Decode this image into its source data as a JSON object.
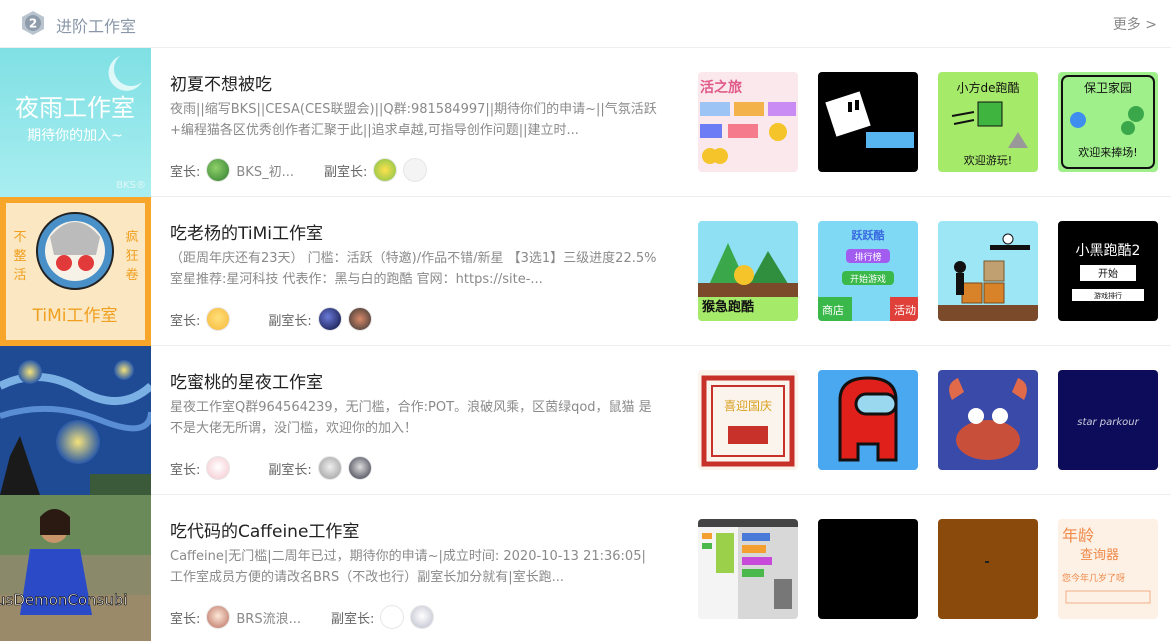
{
  "header": {
    "badge_num": "2",
    "title": "进阶工作室",
    "more": "更多 >"
  },
  "labels": {
    "owner": "室长:",
    "deputy": "副室长:"
  },
  "studios": [
    {
      "name": "初夏不想被吃",
      "desc": "夜雨||缩写BKS||CESA(CES联盟会)||Q群:981584997||期待你们的申请~||气氛活跃+编程猫各区优秀创作者汇聚于此||追求卓越,可指导创作问题||建立时...",
      "owner_name": "BKS_初...",
      "cover_texts": [
        "夜雨工作室",
        "期待你的加入~",
        "BKS®"
      ],
      "works": [
        {
          "texts": [
            "活之旅"
          ]
        },
        {
          "texts": []
        },
        {
          "texts": [
            "小方de跑酷",
            "欢迎游玩!"
          ]
        },
        {
          "texts": [
            "保卫家园",
            "欢迎来捧场!"
          ]
        }
      ]
    },
    {
      "name": "吃老杨的TiMi工作室",
      "desc": "（距周年庆还有23天） 门槛：活跃（特邀)/作品不错/新星 【3选1】三级进度22.5% 室星推荐:星河科技 代表作：黑与白的跑酷 官网：https://site-...",
      "owner_name": "",
      "cover_texts": [
        "不",
        "疯",
        "整",
        "狂",
        "活",
        "卷",
        "TiMi工作室"
      ],
      "works": [
        {
          "texts": [
            "猴急跑酷"
          ]
        },
        {
          "texts": [
            "跃跃酷",
            "排行榜",
            "开始游戏",
            "商店",
            "活动"
          ]
        },
        {
          "texts": []
        },
        {
          "texts": [
            "小黑跑酷2",
            "开始",
            "游戏排行"
          ]
        }
      ]
    },
    {
      "name": "吃蜜桃的星夜工作室",
      "desc": "星夜工作室Q群964564239，无门槛，合作:POT。浪破风乘，区茵绿qod，鼠猫 是不是大佬无所谓，没门槛，欢迎你的加入！",
      "owner_name": "",
      "cover_texts": [],
      "works": [
        {
          "texts": [
            "喜迎国庆"
          ]
        },
        {
          "texts": []
        },
        {
          "texts": []
        },
        {
          "texts": [
            "star parkour"
          ]
        }
      ]
    },
    {
      "name": "吃代码的Caffeine工作室",
      "desc": "Caffeine|无门槛|二周年已过，期待你的申请~|成立时间: 2020-10-13 21:36:05|工作室成员方便的请改名BRS（不改也行）副室长加分就有|室长跑...",
      "owner_name": "BRS流浪...",
      "cover_texts": [
        "usDemonConsubi"
      ],
      "works": [
        {
          "texts": []
        },
        {
          "texts": []
        },
        {
          "texts": []
        },
        {
          "texts": [
            "年龄",
            "查询器",
            "您今年几岁了呀"
          ]
        }
      ]
    }
  ],
  "colors": {
    "title": "#222222",
    "desc": "#8a8a8a",
    "header_title": "#8a97a8"
  }
}
